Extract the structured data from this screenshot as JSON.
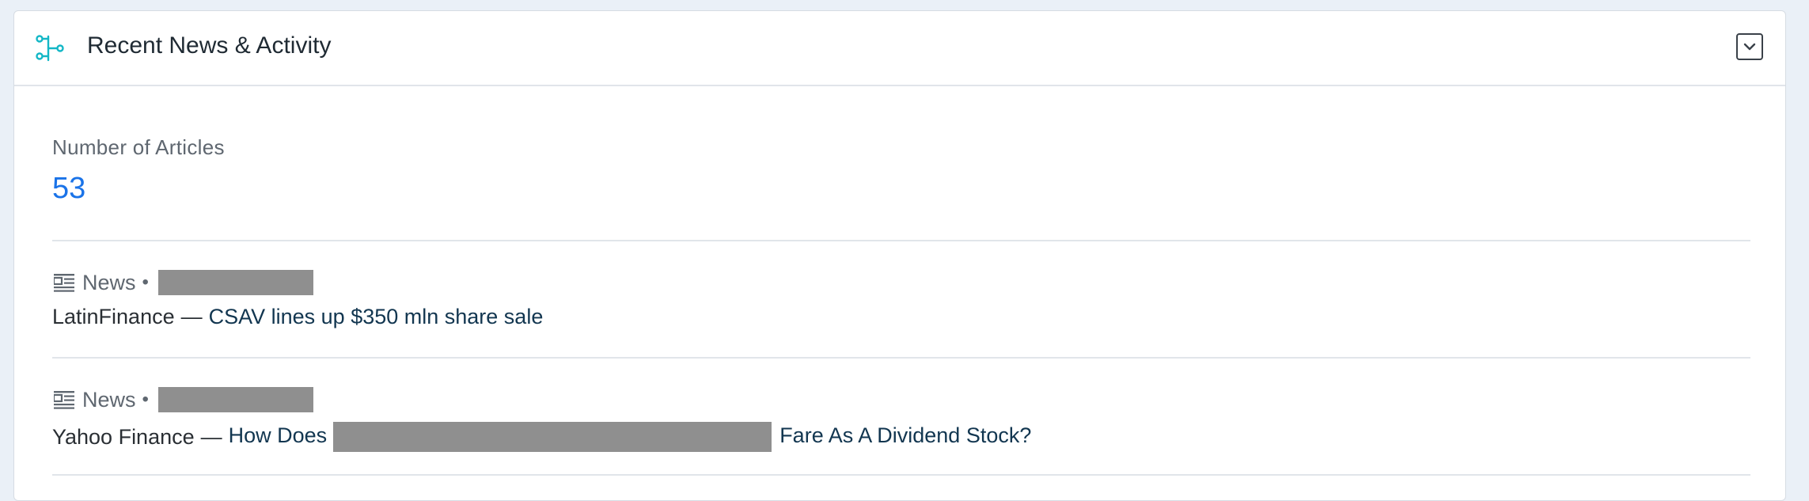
{
  "panel": {
    "title": "Recent News & Activity",
    "title_icon": "news-activity-icon",
    "collapse_icon": "chevron-down-icon",
    "accent_color": "#13b7c6"
  },
  "metric": {
    "label": "Number of Articles",
    "value": "53",
    "value_color": "#1a73e8"
  },
  "news": [
    {
      "type": "News",
      "separator": "•",
      "date_redacted": true,
      "source": "LatinFinance",
      "dash": "—",
      "headline": "CSAV lines up $350 mln share sale"
    },
    {
      "type": "News",
      "separator": "•",
      "date_redacted": true,
      "source": "Yahoo Finance",
      "dash": "—",
      "headline_prefix": "How Does",
      "headline_suffix": "Fare As A Dividend Stock?"
    }
  ]
}
